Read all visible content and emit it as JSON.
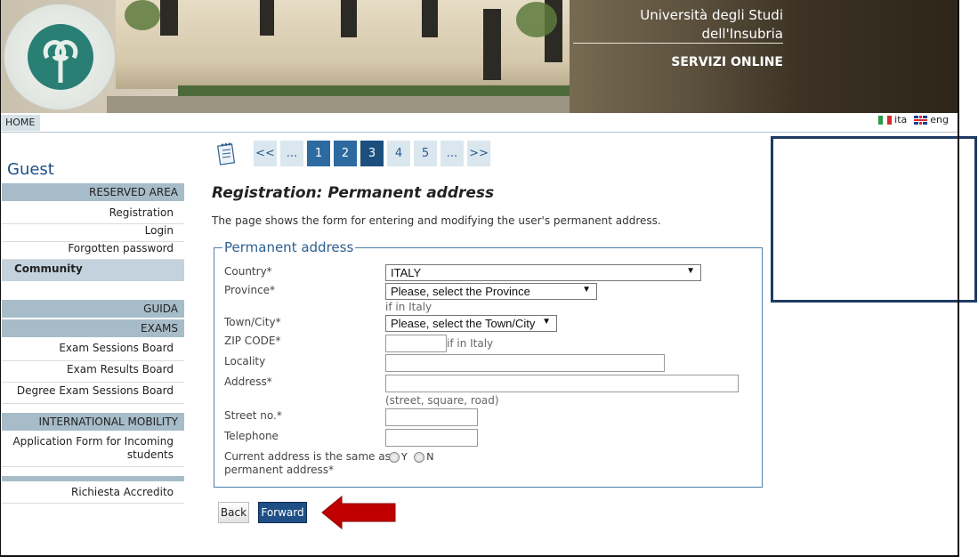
{
  "header": {
    "university_line1": "Università degli Studi",
    "university_line2": "dell'Insubria",
    "service_title": "SERVIZI ONLINE",
    "logo_icon": "university-seal-icon"
  },
  "topnav": {
    "home": "HOME",
    "lang_it": "ita",
    "lang_en": "eng"
  },
  "sidebar": {
    "user": "Guest",
    "reserved_area": "RESERVED AREA",
    "registration": "Registration",
    "login": "Login",
    "forgotten_password": "Forgotten password",
    "community": "Community",
    "guida": "GUIDA",
    "exams": "EXAMS",
    "exam_sessions": "Exam Sessions Board",
    "exam_results": "Exam Results Board",
    "degree_exam_sessions": "Degree Exam Sessions Board",
    "international_mobility": "INTERNATIONAL MOBILITY",
    "application_form_l1": "Application Form for Incoming",
    "application_form_l2": "students",
    "richiesta": "Richiesta Accredito"
  },
  "pager": {
    "first": "<<",
    "ellipsis_start": "...",
    "pages": [
      "1",
      "2",
      "3",
      "4",
      "5"
    ],
    "current": "3",
    "ellipsis_end": "...",
    "last": ">>"
  },
  "main": {
    "title": "Registration: Permanent address",
    "description": "The page shows the form for entering and modifying the user's permanent address.",
    "legend": "Permanent address"
  },
  "form": {
    "country_label": "Country*",
    "country_value": "ITALY",
    "province_label": "Province*",
    "province_value": "Please, select the Province",
    "province_note": "if in Italy",
    "town_label": "Town/City*",
    "town_value": "Please, select the Town/City",
    "zip_label": "ZIP CODE*",
    "zip_note": "if in Italy",
    "locality_label": "Locality",
    "address_label": "Address*",
    "address_note": "(street, square, road)",
    "street_no_label": "Street no.*",
    "telephone_label": "Telephone",
    "same_address_l1": "Current address is the same as",
    "same_address_l2": "permanent address*",
    "radio_yes": "Y",
    "radio_no": "N"
  },
  "buttons": {
    "back": "Back",
    "forward": "Forward"
  },
  "colors": {
    "accent_blue": "#1f4f85",
    "sidebar_band": "#a7bcc9",
    "annotation_red": "#c00000",
    "annotation_box": "#1d3b63"
  }
}
